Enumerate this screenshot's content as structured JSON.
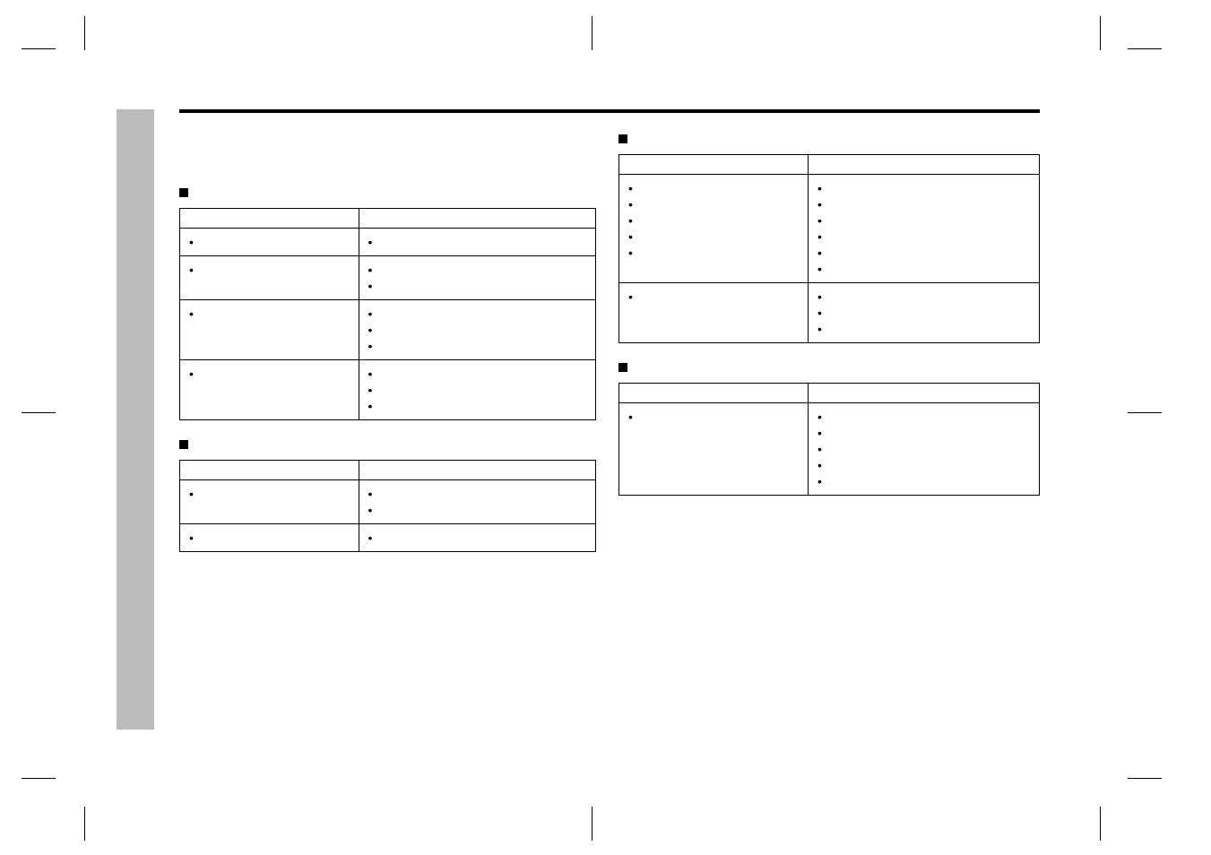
{
  "sections": {
    "a": {
      "title": "",
      "col_cause": "",
      "col_solution": ""
    },
    "b": {
      "title": "",
      "col_cause": "",
      "col_solution": ""
    },
    "c": {
      "title": "",
      "col_cause": "",
      "col_solution": ""
    },
    "d": {
      "title": "",
      "col_cause": "",
      "col_solution": ""
    }
  },
  "tables": {
    "a": [
      {
        "causes": [
          ""
        ],
        "solutions": [
          ""
        ]
      },
      {
        "causes": [
          ""
        ],
        "solutions": [
          "",
          ""
        ]
      },
      {
        "causes": [
          ""
        ],
        "solutions": [
          "",
          "",
          ""
        ]
      },
      {
        "causes": [
          ""
        ],
        "solutions": [
          "  ",
          "  ",
          ""
        ]
      }
    ],
    "b": [
      {
        "causes": [
          ""
        ],
        "solutions": [
          "",
          "  "
        ]
      },
      {
        "causes": [
          ""
        ],
        "solutions": [
          ""
        ]
      }
    ],
    "c": [
      {
        "causes": [
          "  ",
          "  ",
          "",
          "  ",
          ""
        ],
        "solutions": [
          "",
          "  ",
          "",
          "  ",
          "",
          ""
        ]
      },
      {
        "causes": [
          ""
        ],
        "solutions": [
          "  ",
          "",
          ""
        ]
      }
    ],
    "d": [
      {
        "causes": [
          ""
        ],
        "solutions": [
          "  ",
          "",
          "",
          "",
          ""
        ]
      }
    ]
  },
  "col_widths": {
    "cause": "43%",
    "solution": "57%"
  }
}
